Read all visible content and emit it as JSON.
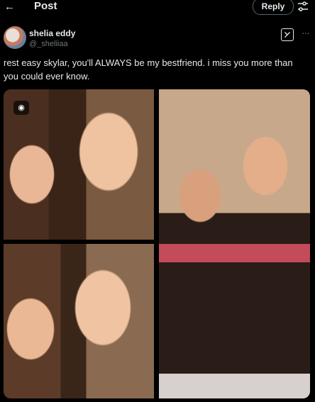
{
  "header": {
    "back_icon": "arrow-left-icon",
    "title": "Post",
    "reply_label": "Reply",
    "settings_icon": "sliders-icon"
  },
  "author": {
    "display_name": "shelia eddy",
    "handle": "@_sheliiaa"
  },
  "post": {
    "text": "rest easy skylar, you'll ALWAYS be my bestfriend. i miss you more than you could ever know."
  },
  "media": {
    "photo_count": 3,
    "badge_icon": "camera-icon"
  },
  "icons": {
    "grok": "grok-icon",
    "more": "more-icon"
  }
}
